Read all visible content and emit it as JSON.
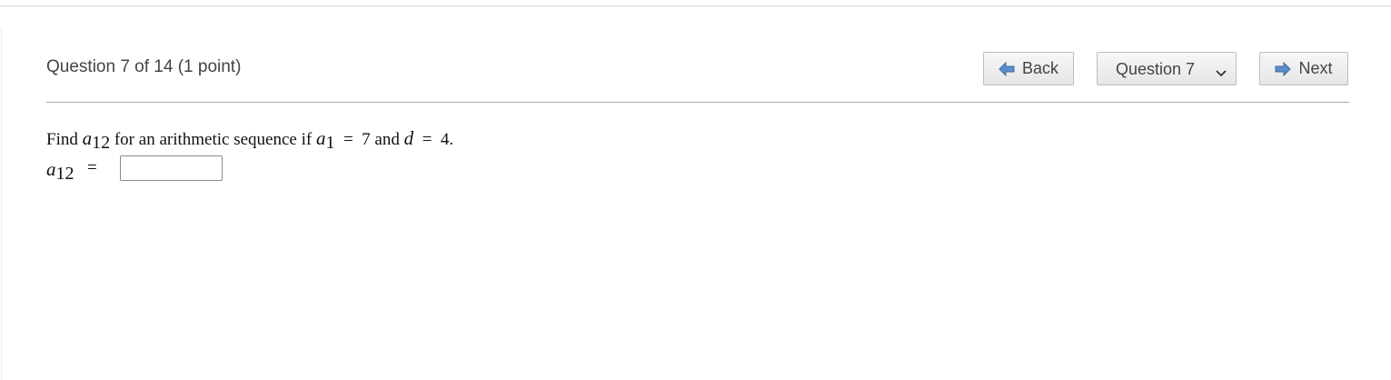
{
  "header": {
    "question_title": "Question 7 of 14 (1 point)",
    "back_label": "Back",
    "next_label": "Next",
    "question_select": {
      "selected": "Question 7"
    }
  },
  "question": {
    "find": "Find",
    "var_a": "a",
    "sub_12": "12",
    "text_mid": "for an arithmetic sequence if",
    "sub_1": "1",
    "eq_sign": "=",
    "a1_value": "7",
    "and": "and",
    "var_d": "d",
    "d_value": "4."
  },
  "answer": {
    "var_a": "a",
    "sub_12": "12",
    "eq_sign": "=",
    "value": ""
  },
  "colors": {
    "arrow_fill": "#5b8fc9",
    "button_border": "#bdbdbd",
    "divider": "#a8a8a8"
  },
  "icons": {
    "back": "arrow-left-icon",
    "next": "arrow-right-icon",
    "dropdown": "chevron-down-icon"
  }
}
